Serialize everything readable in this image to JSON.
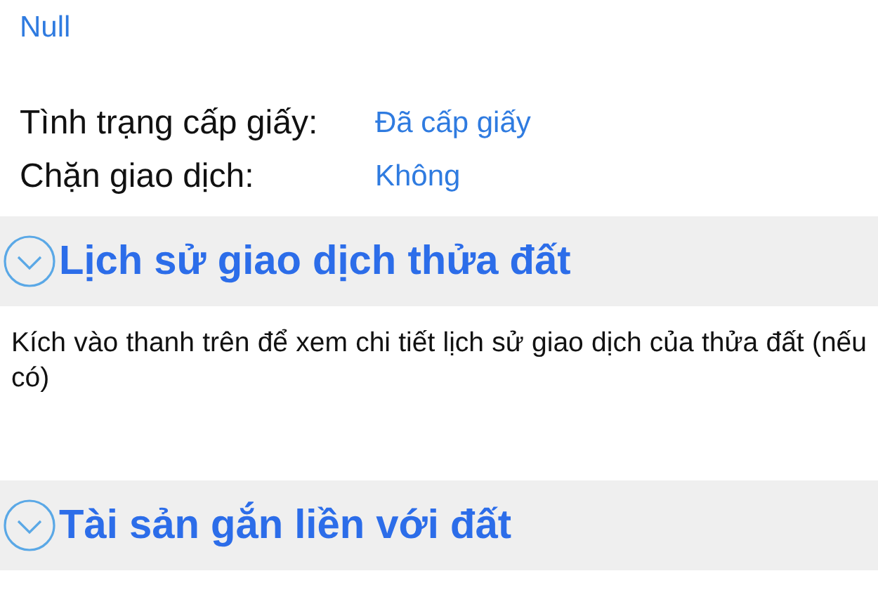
{
  "top_value": "Null",
  "fields": [
    {
      "label": "Tình trạng cấp giấy:",
      "value": "Đã cấp giấy"
    },
    {
      "label": "Chặn giao dịch:",
      "value": "Không"
    }
  ],
  "sections": [
    {
      "title": "Lịch sử giao dịch thửa đất",
      "expanded": false,
      "description": "Kích vào thanh trên để xem chi tiết lịch sử giao dịch của thửa đất (nếu có)"
    },
    {
      "title": "Tài sản gắn liền với đất",
      "expanded": false
    }
  ]
}
